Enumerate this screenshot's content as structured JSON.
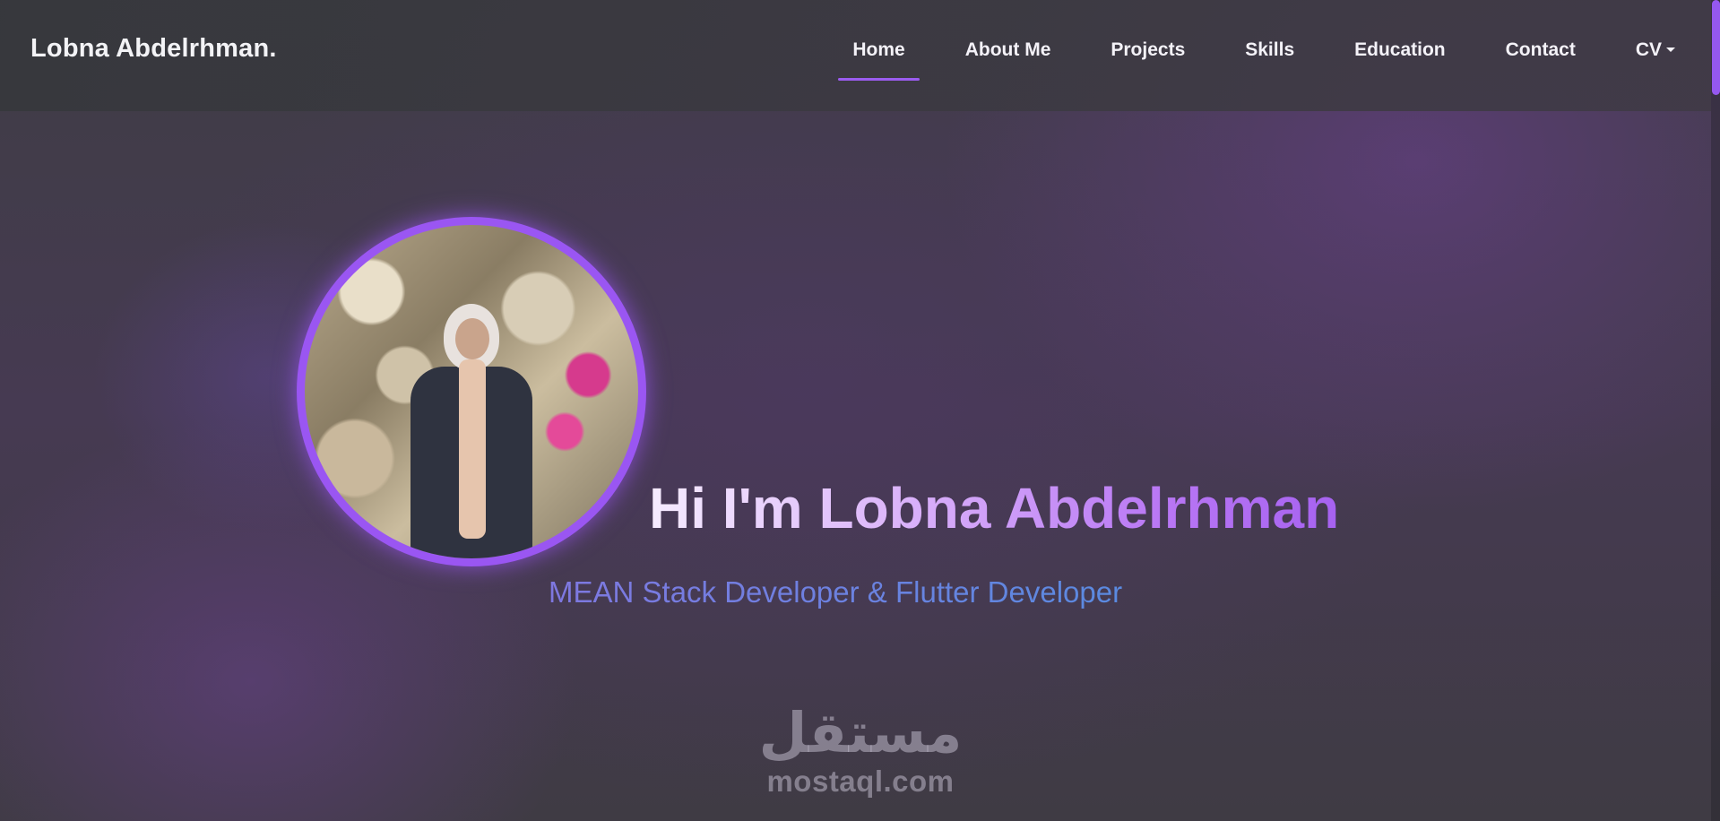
{
  "navbar": {
    "brand": "Lobna Abdelrhman.",
    "items": [
      {
        "label": "Home",
        "active": true
      },
      {
        "label": "About Me"
      },
      {
        "label": "Projects"
      },
      {
        "label": "Skills"
      },
      {
        "label": "Education"
      },
      {
        "label": "Contact"
      },
      {
        "label": "CV",
        "dropdown": true
      }
    ]
  },
  "hero": {
    "title": "Hi I'm Lobna Abdelrhman",
    "subtitle": "MEAN Stack Developer & Flutter Developer",
    "avatar_icon": "profile-photo"
  },
  "watermark": {
    "arabic": "مستقل",
    "latin": "mostaql.com"
  },
  "colors": {
    "accent": "#9b5cf0",
    "subtitle": "#6f86df",
    "nav_text": "#f4f2f8"
  }
}
